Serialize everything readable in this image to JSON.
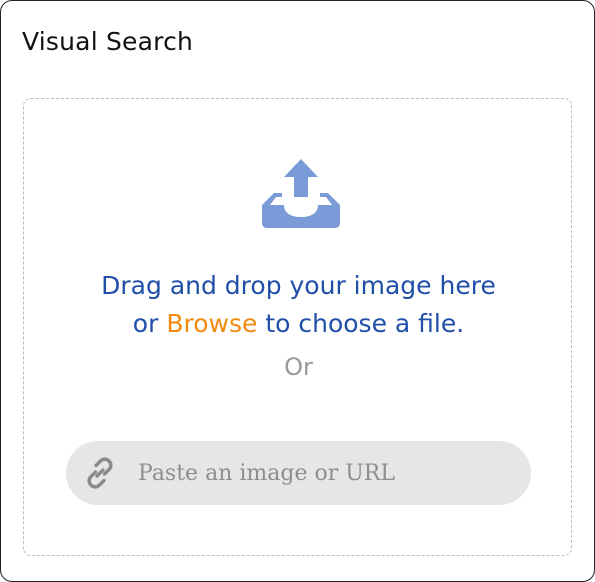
{
  "panel": {
    "title": "Visual Search"
  },
  "dropzone": {
    "instruction_line1": "Drag and drop your image here",
    "instruction_prefix": "or",
    "browse_label": "Browse",
    "instruction_suffix": "to choose a file.",
    "or_label": "Or",
    "upload_icon": "upload-tray-icon"
  },
  "url_bar": {
    "placeholder": "Paste an image or URL",
    "value": "",
    "icon": "link-icon"
  },
  "colors": {
    "accent_blue": "#1f4fa8",
    "browse_orange": "#f28a0f",
    "icon_blue": "#7b9bd8",
    "input_background": "#e6e6e6",
    "muted_text": "#999999"
  }
}
